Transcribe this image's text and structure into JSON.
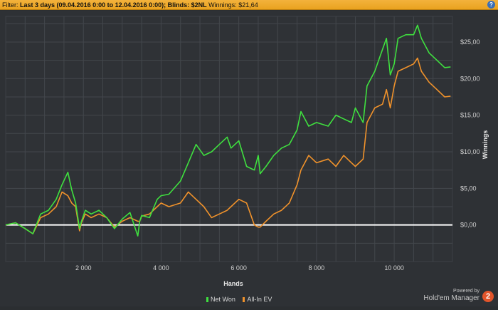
{
  "filter": {
    "prefix": "Filter: ",
    "range": "Last 3 days (09.04.2016 0:00 to 12.04.2016 0:00); Blinds: $2NL",
    "winnings": "Winnings: $21,64"
  },
  "help_icon": "?",
  "brand": {
    "powered": "Powered by",
    "name": "Hold'em Manager",
    "logo": "2"
  },
  "colors": {
    "net_won": "#3fe03f",
    "all_in_ev": "#f0922b",
    "zero_line": "#ffffff",
    "filter_bar": "#eea827"
  },
  "chart_data": {
    "type": "line",
    "xlabel": "Hands",
    "ylabel": "Winnings",
    "xlim": [
      0,
      11500
    ],
    "ylim": [
      -5,
      28.5
    ],
    "xticks": [
      2000,
      4000,
      6000,
      8000,
      10000
    ],
    "xtick_labels": [
      "2 000",
      "4 000",
      "6 000",
      "8 000",
      "10 000"
    ],
    "yticks": [
      0,
      5,
      10,
      15,
      20,
      25
    ],
    "ytick_labels": [
      "$0,00",
      "$5,00",
      "$10,00",
      "$15,00",
      "$20,00",
      "$25,00"
    ],
    "grid": true,
    "legend_position": "bottom",
    "zero_line": 0,
    "series": [
      {
        "name": "Net Won",
        "x": [
          0,
          250,
          500,
          700,
          900,
          1100,
          1300,
          1450,
          1600,
          1700,
          1800,
          1900,
          1950,
          2050,
          2200,
          2400,
          2600,
          2800,
          3000,
          3200,
          3400,
          3450,
          3500,
          3700,
          3900,
          4000,
          4200,
          4500,
          4700,
          4900,
          5100,
          5300,
          5500,
          5700,
          5800,
          6000,
          6200,
          6400,
          6500,
          6550,
          6700,
          6900,
          7100,
          7300,
          7500,
          7600,
          7800,
          8000,
          8300,
          8500,
          8700,
          8900,
          9000,
          9200,
          9300,
          9500,
          9700,
          9800,
          9900,
          10000,
          10100,
          10300,
          10500,
          10600,
          10700,
          10900,
          11100,
          11300,
          11450
        ],
        "values": [
          0,
          0.3,
          -0.5,
          -1.2,
          1.5,
          2.0,
          3.5,
          5.5,
          7.2,
          4.8,
          3.0,
          -0.5,
          0.5,
          2.0,
          1.5,
          2.0,
          1.0,
          -0.5,
          0.8,
          1.7,
          -1.5,
          0.5,
          1.3,
          1.0,
          3.5,
          4.0,
          4.2,
          6.0,
          8.5,
          11.0,
          9.5,
          10.0,
          11.0,
          12.0,
          10.5,
          11.5,
          8.0,
          7.5,
          9.5,
          7.0,
          8.0,
          9.5,
          10.5,
          11.0,
          13.0,
          15.5,
          13.5,
          14.0,
          13.5,
          15.0,
          14.5,
          14.0,
          16.0,
          14.0,
          19.0,
          21.0,
          24.0,
          25.5,
          20.5,
          22.0,
          25.5,
          26.0,
          26.0,
          27.3,
          25.5,
          23.5,
          22.5,
          21.5,
          21.6
        ]
      },
      {
        "name": "All-In EV",
        "x": [
          0,
          250,
          500,
          700,
          900,
          1100,
          1300,
          1450,
          1600,
          1700,
          1800,
          1900,
          1950,
          2050,
          2200,
          2400,
          2600,
          2800,
          3000,
          3200,
          3400,
          3450,
          3500,
          3700,
          3900,
          4000,
          4200,
          4500,
          4700,
          4900,
          5100,
          5300,
          5500,
          5700,
          5800,
          6000,
          6200,
          6400,
          6500,
          6550,
          6700,
          6900,
          7100,
          7300,
          7500,
          7600,
          7800,
          8000,
          8300,
          8500,
          8700,
          8900,
          9000,
          9200,
          9300,
          9500,
          9700,
          9800,
          9900,
          10000,
          10100,
          10300,
          10500,
          10600,
          10700,
          10900,
          11100,
          11300,
          11450
        ],
        "values": [
          0,
          0.3,
          -0.5,
          -1.2,
          1.0,
          1.5,
          2.5,
          4.5,
          4.0,
          3.0,
          2.5,
          -0.8,
          0.3,
          1.5,
          1.0,
          1.5,
          1.0,
          -0.3,
          0.5,
          1.0,
          0.5,
          0.5,
          1.2,
          1.5,
          2.5,
          3.0,
          2.5,
          3.0,
          4.5,
          3.5,
          2.5,
          1.0,
          1.5,
          2.0,
          2.5,
          3.5,
          3.0,
          0,
          -0.3,
          -0.3,
          0.5,
          1.5,
          2.0,
          3.0,
          5.5,
          7.5,
          9.5,
          8.5,
          9.0,
          8.0,
          9.5,
          8.5,
          8.0,
          9.0,
          14.0,
          16.0,
          16.5,
          18.5,
          16.0,
          19.0,
          21.0,
          21.5,
          22.0,
          22.8,
          21.0,
          19.5,
          18.5,
          17.5,
          17.6
        ]
      }
    ]
  }
}
